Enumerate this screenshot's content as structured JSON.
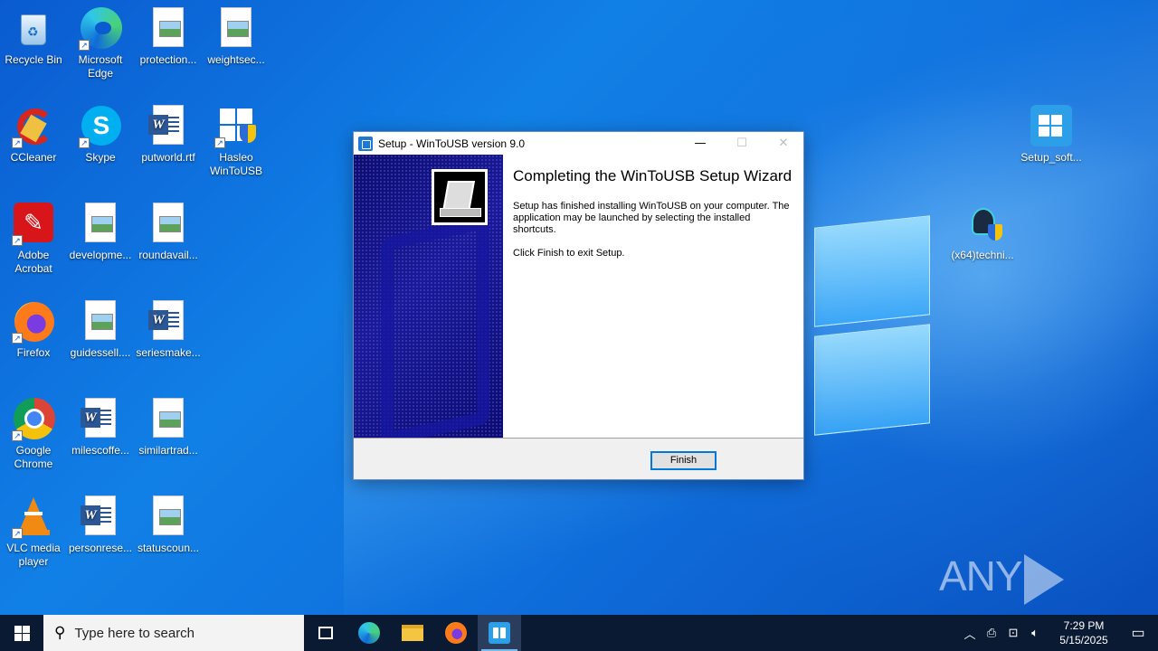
{
  "desktop": {
    "icons": [
      {
        "label": "Recycle Bin",
        "icon": "recycle-bin-icon"
      },
      {
        "label": "Microsoft Edge",
        "icon": "edge-icon"
      },
      {
        "label": "protection...",
        "icon": "image-file-icon"
      },
      {
        "label": "weightsec...",
        "icon": "image-file-icon"
      },
      {
        "label": "CCleaner",
        "icon": "ccleaner-icon"
      },
      {
        "label": "Skype",
        "icon": "skype-icon"
      },
      {
        "label": "putworld.rtf",
        "icon": "word-doc-icon"
      },
      {
        "label": "Hasleo WinToUSB",
        "icon": "wintousb-icon"
      },
      {
        "label": "Adobe Acrobat",
        "icon": "acrobat-icon"
      },
      {
        "label": "developme...",
        "icon": "image-file-icon"
      },
      {
        "label": "roundavail...",
        "icon": "image-file-icon"
      },
      {
        "label": "Firefox",
        "icon": "firefox-icon"
      },
      {
        "label": "guidessell....",
        "icon": "image-file-icon"
      },
      {
        "label": "seriesmake...",
        "icon": "word-doc-icon"
      },
      {
        "label": "Google Chrome",
        "icon": "chrome-icon"
      },
      {
        "label": "milescoffe...",
        "icon": "word-doc-icon"
      },
      {
        "label": "similartrad...",
        "icon": "image-file-icon"
      },
      {
        "label": "VLC media player",
        "icon": "vlc-icon"
      },
      {
        "label": "personrese...",
        "icon": "word-doc-icon"
      },
      {
        "label": "statuscoun...",
        "icon": "image-file-icon"
      },
      {
        "label": "Setup_soft...",
        "icon": "setup-app-icon"
      },
      {
        "label": "(x64)techni...",
        "icon": "installer-icon"
      }
    ]
  },
  "window": {
    "title": "Setup - WinToUSB version 9.0",
    "minimize": "—",
    "maximize": "☐",
    "close": "✕",
    "heading": "Completing the WinToUSB Setup Wizard",
    "body": "Setup has finished installing WinToUSB on your computer. The application may be launched by selecting the installed shortcuts.",
    "instruction": "Click Finish to exit Setup.",
    "finish_label": "Finish"
  },
  "watermark": {
    "left": "ANY",
    "right": "RUN"
  },
  "taskbar": {
    "search_placeholder": "Type here to search",
    "time": "7:29 PM",
    "date": "5/15/2025",
    "pinned": [
      "task-view-icon",
      "edge-icon",
      "file-explorer-icon",
      "firefox-icon",
      "wintousb-icon"
    ]
  },
  "colors": {
    "accent": "#0078d7",
    "taskbar": "#0b1a33",
    "banner": "#0c0c6e"
  }
}
